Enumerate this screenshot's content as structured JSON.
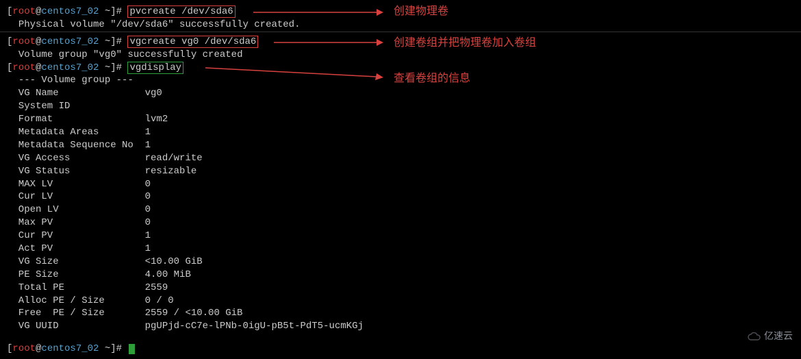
{
  "prompts": {
    "user": "root",
    "host": "centos7_02",
    "cwd": "~",
    "symbol": "]#"
  },
  "cmd1": "pvcreate /dev/sda6",
  "cmd1_out": "Physical volume \"/dev/sda6\" successfully created.",
  "cmd2": "vgcreate vg0 /dev/sda6",
  "cmd2_out": "Volume group \"vg0\" successfully created",
  "cmd3": "vgdisplay",
  "vg": {
    "header": "--- Volume group ---",
    "fields": [
      [
        "VG Name",
        "vg0"
      ],
      [
        "System ID",
        ""
      ],
      [
        "Format",
        "lvm2"
      ],
      [
        "Metadata Areas",
        "1"
      ],
      [
        "Metadata Sequence No",
        "1"
      ],
      [
        "VG Access",
        "read/write"
      ],
      [
        "VG Status",
        "resizable"
      ],
      [
        "MAX LV",
        "0"
      ],
      [
        "Cur LV",
        "0"
      ],
      [
        "Open LV",
        "0"
      ],
      [
        "Max PV",
        "0"
      ],
      [
        "Cur PV",
        "1"
      ],
      [
        "Act PV",
        "1"
      ],
      [
        "VG Size",
        "<10.00 GiB"
      ],
      [
        "PE Size",
        "4.00 MiB"
      ],
      [
        "Total PE",
        "2559"
      ],
      [
        "Alloc PE / Size",
        "0 / 0"
      ],
      [
        "Free  PE / Size",
        "2559 / <10.00 GiB"
      ],
      [
        "VG UUID",
        "pgUPjd-cC7e-lPNb-0igU-pB5t-PdT5-ucmKGj"
      ]
    ]
  },
  "annotations": {
    "a1": "创建物理卷",
    "a2": "创建卷组并把物理卷加入卷组",
    "a3": "查看卷组的信息"
  },
  "watermark": "亿速云"
}
